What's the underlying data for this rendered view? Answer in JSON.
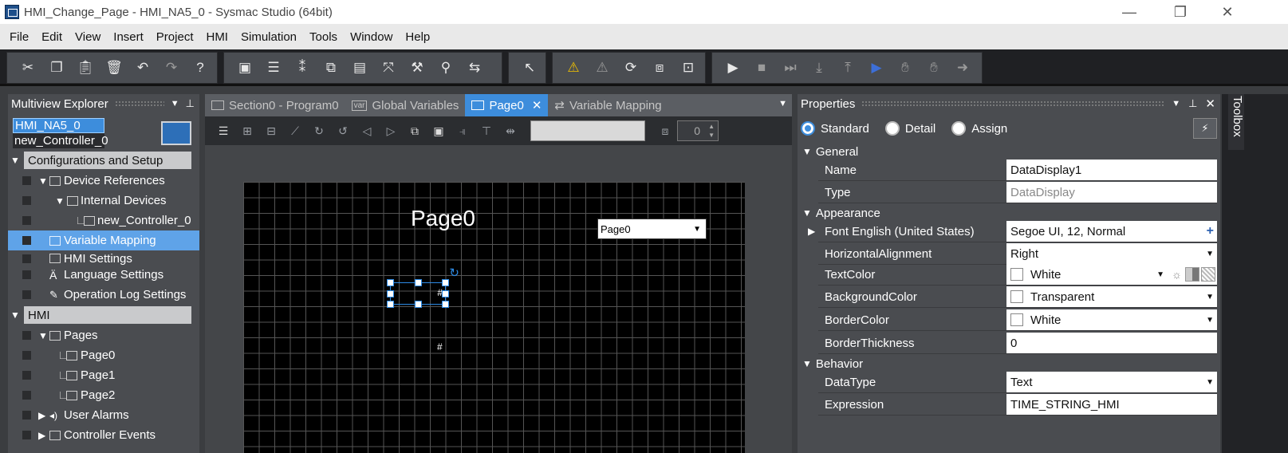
{
  "window": {
    "title": "HMI_Change_Page - HMI_NA5_0 - Sysmac Studio (64bit)",
    "minimize": "—",
    "restore": "❐",
    "close": "✕"
  },
  "menu": [
    "File",
    "Edit",
    "View",
    "Insert",
    "Project",
    "HMI",
    "Simulation",
    "Tools",
    "Window",
    "Help"
  ],
  "toolbar": {
    "group1": [
      "cut-icon",
      "copy-icon",
      "paste-icon",
      "delete-icon",
      "undo-icon",
      "redo-icon",
      "help-icon"
    ],
    "group2": [
      "3d-icon",
      "tree-icon",
      "cross-ref-icon",
      "layers-icon",
      "watch-icon",
      "compare-icon",
      "build-icon",
      "find-icon",
      "transfer-icon"
    ],
    "group3": [
      "monitor-icon"
    ],
    "group4": [
      "warning-icon",
      "no-sync-icon",
      "refresh-icon",
      "diff-icon",
      "window-icon"
    ],
    "group5": [
      "play-icon",
      "stop-icon",
      "step-icon",
      "step-in-icon",
      "step-out-icon",
      "pause-icon",
      "hand-icon",
      "hand-stop-icon",
      "arrow-right-icon"
    ]
  },
  "explorer": {
    "title": "Multiview Explorer",
    "devices": [
      "HMI_NA5_0",
      "new_Controller_0"
    ],
    "section1": "Configurations and Setup",
    "items1": [
      {
        "label": "Device References",
        "expand": "▼"
      },
      {
        "label": "Internal Devices",
        "expand": "▼"
      },
      {
        "label": "new_Controller_0",
        "expand": ""
      },
      {
        "label": "Variable Mapping",
        "expand": ""
      },
      {
        "label": "HMI Settings",
        "expand": ""
      },
      {
        "label": "Language Settings",
        "expand": ""
      },
      {
        "label": "Operation Log Settings",
        "expand": ""
      }
    ],
    "section2": "HMI",
    "items2": [
      {
        "label": "Pages",
        "expand": "▼"
      },
      {
        "label": "Page0",
        "expand": ""
      },
      {
        "label": "Page1",
        "expand": ""
      },
      {
        "label": "Page2",
        "expand": ""
      },
      {
        "label": "User Alarms",
        "expand": "▶"
      },
      {
        "label": "Controller Events",
        "expand": "▶"
      }
    ]
  },
  "editor": {
    "tabs": [
      {
        "label": "Section0 - Program0",
        "active": false
      },
      {
        "label": "Global Variables",
        "active": false
      },
      {
        "label": "Page0",
        "active": true
      },
      {
        "label": "Variable Mapping",
        "active": false
      }
    ],
    "spin_value": "0",
    "page_title": "Page0",
    "dropdown_value": "Page0",
    "data_display_1": "#",
    "data_display_2": "#"
  },
  "properties": {
    "title": "Properties",
    "modes": [
      {
        "label": "Standard",
        "selected": true
      },
      {
        "label": "Detail",
        "selected": false
      },
      {
        "label": "Assign",
        "selected": false
      }
    ],
    "categories": [
      "General",
      "Appearance",
      "Behavior"
    ],
    "rows": [
      {
        "name": "Name",
        "value": "DataDisplay1",
        "readonly": false,
        "control": ""
      },
      {
        "name": "Type",
        "value": "DataDisplay",
        "readonly": true,
        "control": ""
      },
      {
        "name": "Font English (United States)",
        "value": "Segoe UI, 12, Normal",
        "readonly": false,
        "control": "plus"
      },
      {
        "name": "HorizontalAlignment",
        "value": "Right",
        "readonly": false,
        "control": "dropdown"
      },
      {
        "name": "TextColor",
        "value": "White",
        "readonly": false,
        "control": "color-tools"
      },
      {
        "name": "BackgroundColor",
        "value": "Transparent",
        "readonly": false,
        "control": "dropdown"
      },
      {
        "name": "BorderColor",
        "value": "White",
        "readonly": false,
        "control": "dropdown"
      },
      {
        "name": "BorderThickness",
        "value": "0",
        "readonly": false,
        "control": ""
      },
      {
        "name": "DataType",
        "value": "Text",
        "readonly": false,
        "control": "dropdown"
      },
      {
        "name": "Expression",
        "value": "TIME_STRING_HMI",
        "readonly": false,
        "control": ""
      }
    ]
  },
  "toolbox": {
    "label": "Toolbox"
  },
  "colors": {
    "accent": "#3d8ddc",
    "panel": "#4a4c50",
    "canvas": "#000000",
    "warning": "#f2c200"
  }
}
